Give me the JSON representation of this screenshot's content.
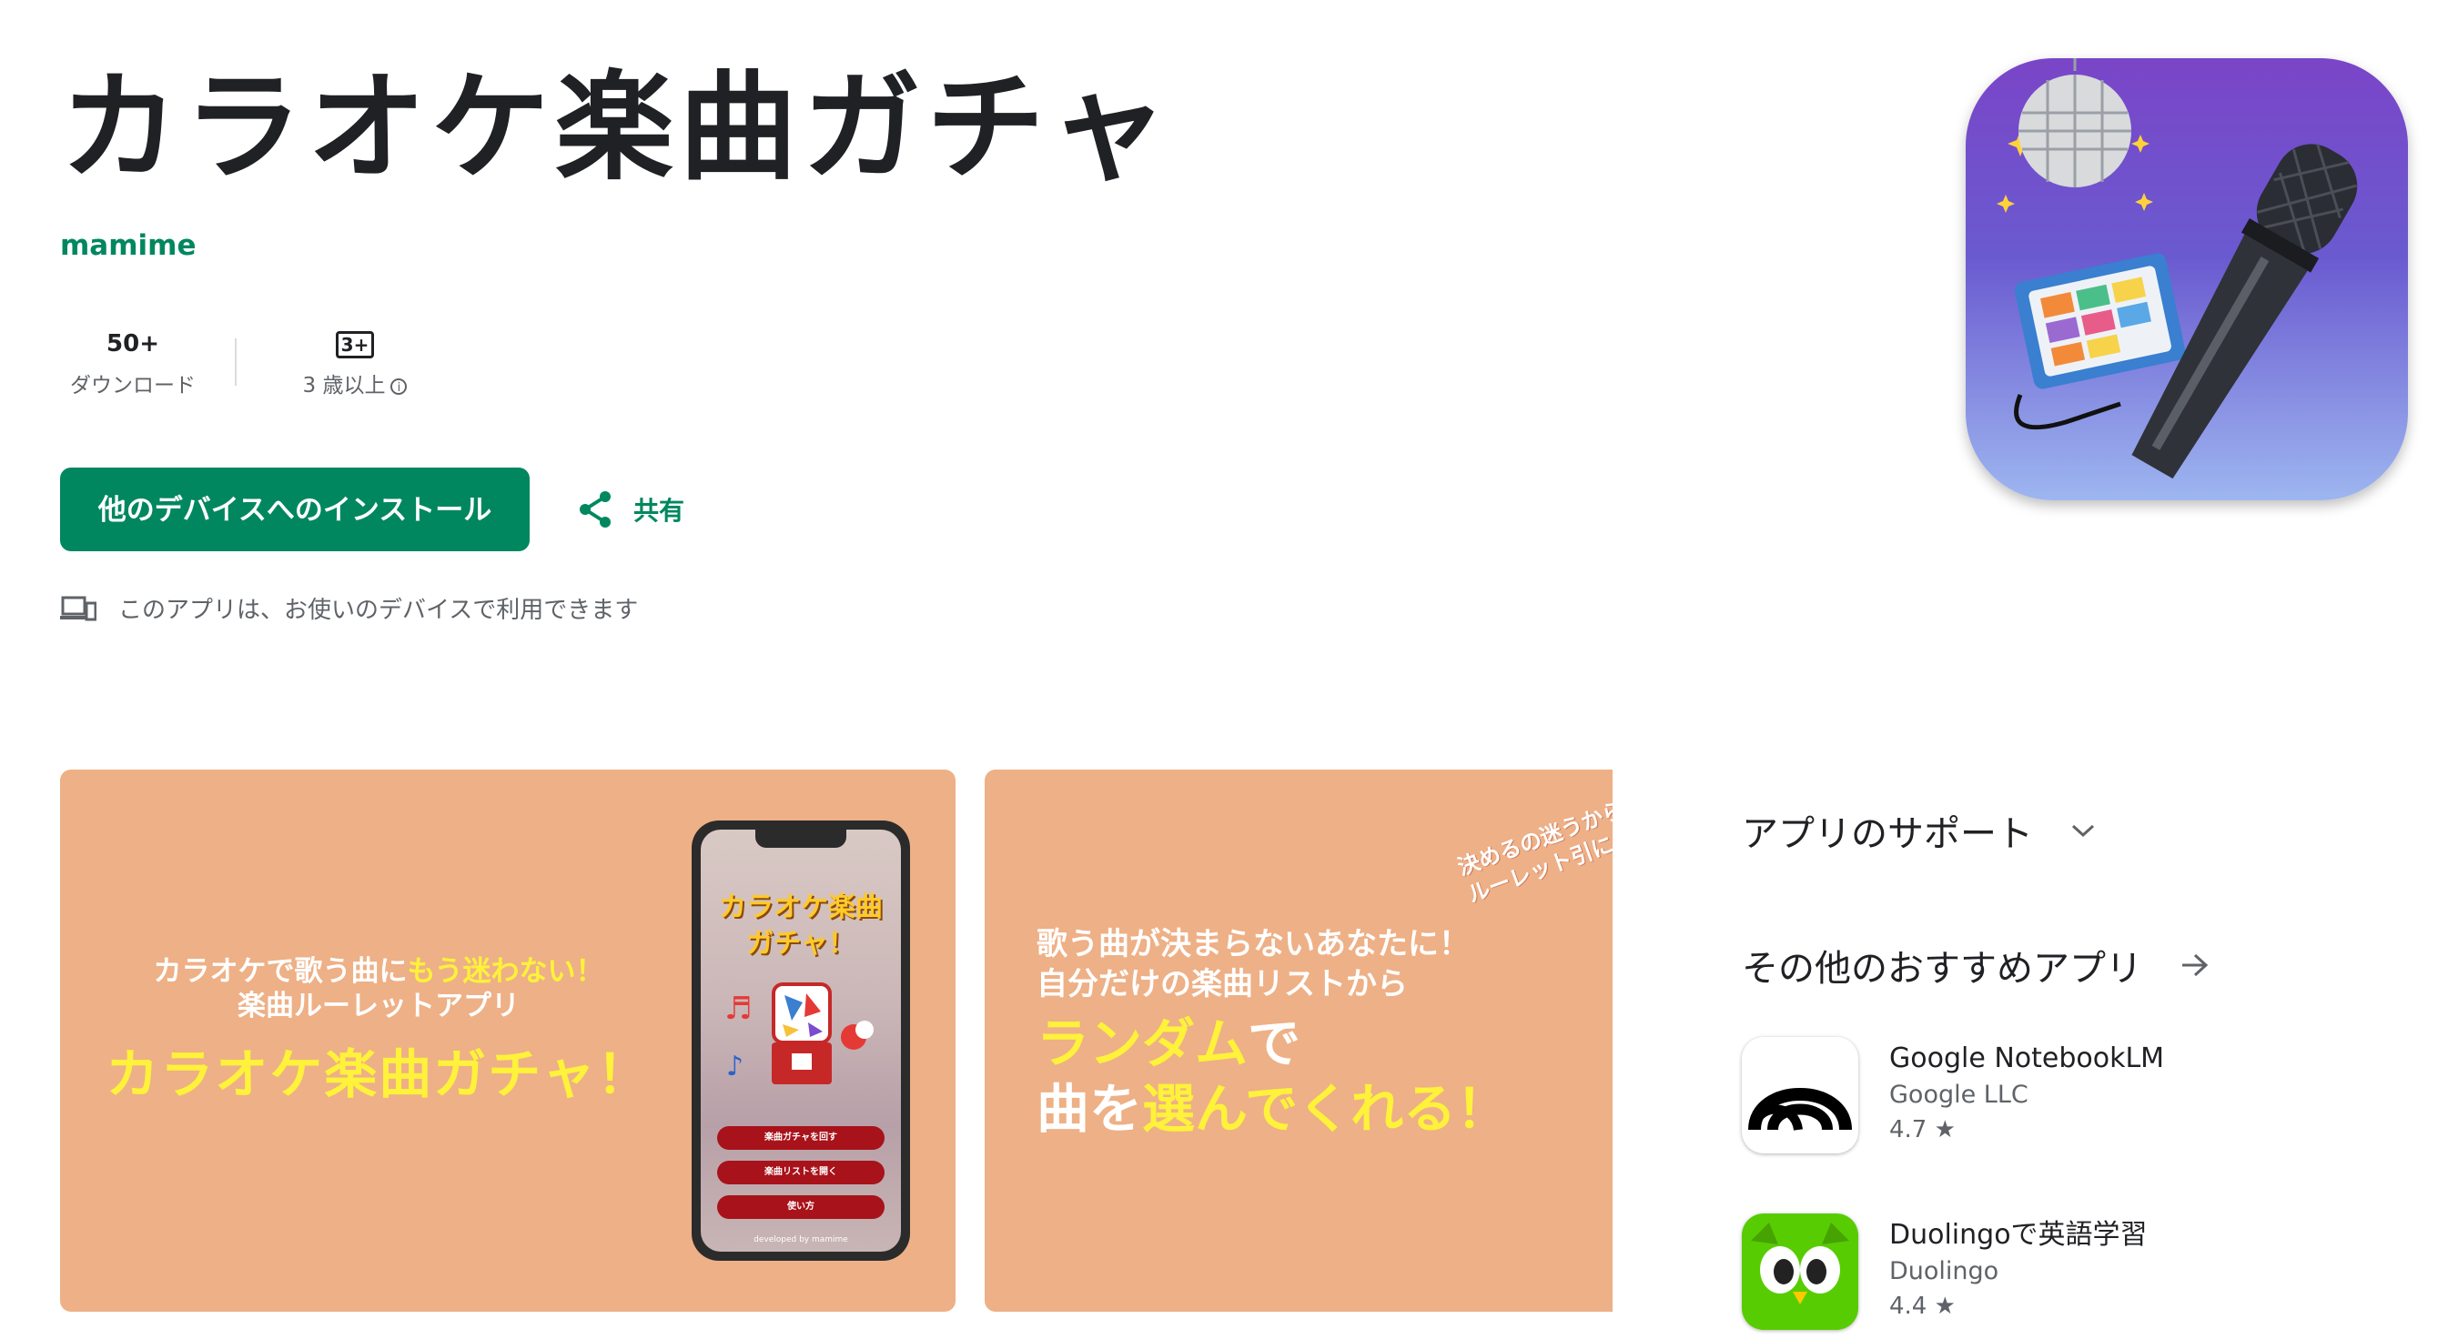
{
  "app": {
    "title": "カラオケ楽曲ガチャ",
    "developer": "mamime",
    "downloads_value": "50+",
    "downloads_label": "ダウンロード",
    "rating_badge": "3+",
    "rating_label": "3 歳以上",
    "install_label": "他のデバイスへのインストール",
    "share_label": "共有",
    "devices_note": "このアプリは、お使いのデバイスで利用できます"
  },
  "screenshot1": {
    "line1_pre": "カラオケで歌う曲に",
    "line1_hl": "もう迷わない！",
    "line2": "楽曲ルーレットアプリ",
    "big": "カラオケ楽曲ガチャ！",
    "phone_title_1": "カラオケ楽曲",
    "phone_title_2": "ガチャ！",
    "phone_btn1": "楽曲ガチャを回す",
    "phone_btn2": "楽曲リストを開く",
    "phone_btn3": "使い方",
    "phone_footer": "developed by mamime"
  },
  "screenshot2": {
    "corner_1": "決めるの迷うから",
    "corner_2": "ルーレット引に！",
    "line1": "歌う曲が決まらないあなたに！",
    "line2": "自分だけの楽曲リストから",
    "big1_hl": "ランダム",
    "big1_rest": "で",
    "big2_pre": "曲を",
    "big2_hl": "選んでくれる！"
  },
  "sidebar": {
    "support_title": "アプリのサポート",
    "recommend_title": "その他のおすすめアプリ",
    "recommendations": [
      {
        "name": "Google NotebookLM",
        "developer": "Google LLC",
        "rating": "4.7 ★"
      },
      {
        "name": "Duolingoで英語学習",
        "developer": "Duolingo",
        "rating": "4.4 ★"
      }
    ]
  },
  "colors": {
    "accent": "#01875f",
    "screenshot_bg": "#eeb086",
    "highlight_yellow": "#fff23a"
  }
}
